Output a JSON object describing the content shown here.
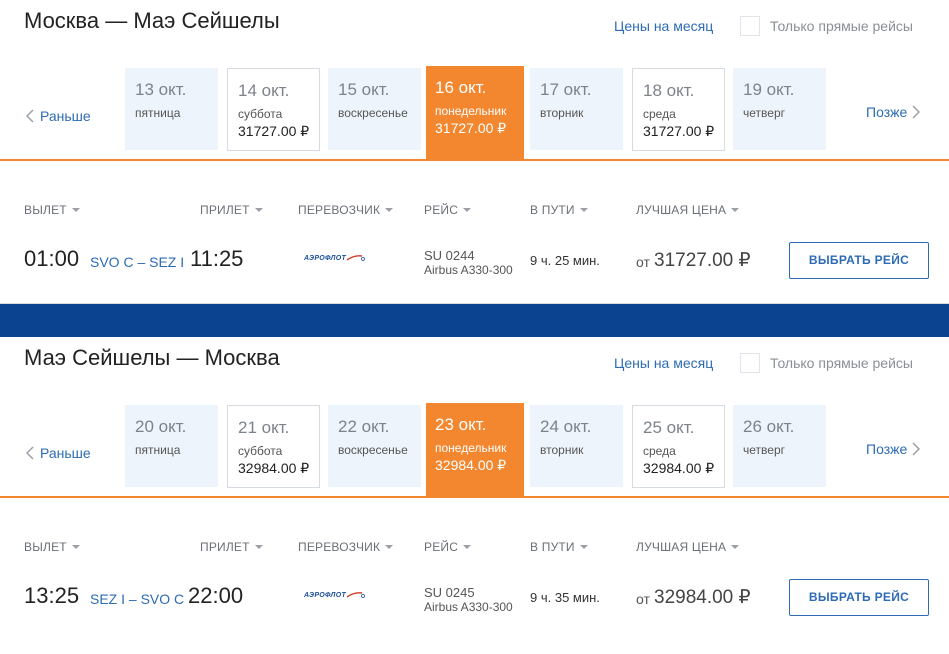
{
  "outbound": {
    "route_title": "Москва — Маэ Сейшелы",
    "month_link": "Цены на месяц",
    "direct_label": "Только прямые рейсы",
    "prev_label": "Раньше",
    "next_label": "Позже",
    "dates": [
      {
        "date": "13 окт.",
        "weekday": "пятница",
        "price": ""
      },
      {
        "date": "14 окт.",
        "weekday": "суббота",
        "price": "31727.00 ₽"
      },
      {
        "date": "15 окт.",
        "weekday": "воскресенье",
        "price": ""
      },
      {
        "date": "16 окт.",
        "weekday": "понедельник",
        "price": "31727.00 ₽"
      },
      {
        "date": "17 окт.",
        "weekday": "вторник",
        "price": ""
      },
      {
        "date": "18 окт.",
        "weekday": "среда",
        "price": "31727.00 ₽"
      },
      {
        "date": "19 окт.",
        "weekday": "четверг",
        "price": ""
      }
    ],
    "headers": {
      "departure": "ВЫЛЕТ",
      "arrival": "ПРИЛЕТ",
      "carrier": "ПЕРЕВОЗЧИК",
      "flight": "РЕЙС",
      "duration": "В ПУТИ",
      "best_price": "ЛУЧШАЯ ЦЕНА"
    },
    "flight": {
      "dep_time": "01:00",
      "airports": "SVO C – SEZ I",
      "arr_time": "11:25",
      "carrier_logo": "АЭРОФЛОТ",
      "flight_no": "SU 0244",
      "aircraft": "Airbus A330-300",
      "duration": "9 ч. 25 мин.",
      "price_from": "от",
      "price": "31727.00 ₽",
      "select_label": "ВЫБРАТЬ РЕЙС"
    }
  },
  "return": {
    "route_title": "Маэ Сейшелы — Москва",
    "month_link": "Цены на месяц",
    "direct_label": "Только прямые рейсы",
    "prev_label": "Раньше",
    "next_label": "Позже",
    "dates": [
      {
        "date": "20 окт.",
        "weekday": "пятница",
        "price": ""
      },
      {
        "date": "21 окт.",
        "weekday": "суббота",
        "price": "32984.00 ₽"
      },
      {
        "date": "22 окт.",
        "weekday": "воскресенье",
        "price": ""
      },
      {
        "date": "23 окт.",
        "weekday": "понедельник",
        "price": "32984.00 ₽"
      },
      {
        "date": "24 окт.",
        "weekday": "вторник",
        "price": ""
      },
      {
        "date": "25 окт.",
        "weekday": "среда",
        "price": "32984.00 ₽"
      },
      {
        "date": "26 окт.",
        "weekday": "четверг",
        "price": ""
      }
    ],
    "headers": {
      "departure": "ВЫЛЕТ",
      "arrival": "ПРИЛЕТ",
      "carrier": "ПЕРЕВОЗЧИК",
      "flight": "РЕЙС",
      "duration": "В ПУТИ",
      "best_price": "ЛУЧШАЯ ЦЕНА"
    },
    "flight": {
      "dep_time": "13:25",
      "airports": "SEZ I – SVO C",
      "arr_time": "22:00",
      "carrier_logo": "АЭРОФЛОТ",
      "flight_no": "SU 0245",
      "aircraft": "Airbus A330-300",
      "duration": "9 ч. 35 мин.",
      "price_from": "от",
      "price": "32984.00 ₽",
      "select_label": "ВЫБРАТЬ РЕЙС"
    }
  },
  "colors": {
    "accent": "#f2872f",
    "link": "#2d6bb5",
    "band": "#0b4390",
    "cell_bg": "#eef4fb"
  },
  "icons": {
    "prev": "chevron-left-icon",
    "next": "chevron-right-icon",
    "caret": "caret-down-icon",
    "carrier": "aeroflot-logo"
  }
}
